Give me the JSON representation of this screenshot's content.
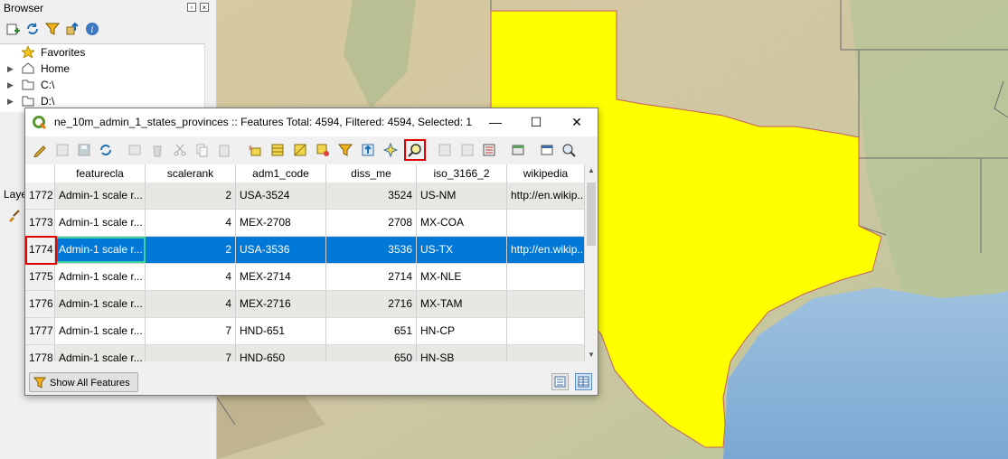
{
  "browser": {
    "title": "Browser",
    "tree": [
      {
        "label": "Favorites"
      },
      {
        "label": "Home"
      },
      {
        "label": "C:\\"
      },
      {
        "label": "D:\\"
      }
    ],
    "layers_label": "Laye"
  },
  "attr_window": {
    "title": "ne_10m_admin_1_states_provinces :: Features Total: 4594, Filtered: 4594, Selected: 1",
    "columns": [
      "featurecla",
      "scalerank",
      "adm1_code",
      "diss_me",
      "iso_3166_2",
      "wikipedia"
    ],
    "rows": [
      {
        "id": "1772",
        "featurecla": "Admin-1 scale r...",
        "scalerank": "2",
        "adm1_code": "USA-3524",
        "diss_me": "3524",
        "iso_3166_2": "US-NM",
        "wikipedia": "http://en.wikip..."
      },
      {
        "id": "1773",
        "featurecla": "Admin-1 scale r...",
        "scalerank": "4",
        "adm1_code": "MEX-2708",
        "diss_me": "2708",
        "iso_3166_2": "MX-COA",
        "wikipedia": ""
      },
      {
        "id": "1774",
        "featurecla": "Admin-1 scale r...",
        "scalerank": "2",
        "adm1_code": "USA-3536",
        "diss_me": "3536",
        "iso_3166_2": "US-TX",
        "wikipedia": "http://en.wikip..."
      },
      {
        "id": "1775",
        "featurecla": "Admin-1 scale r...",
        "scalerank": "4",
        "adm1_code": "MEX-2714",
        "diss_me": "2714",
        "iso_3166_2": "MX-NLE",
        "wikipedia": ""
      },
      {
        "id": "1776",
        "featurecla": "Admin-1 scale r...",
        "scalerank": "4",
        "adm1_code": "MEX-2716",
        "diss_me": "2716",
        "iso_3166_2": "MX-TAM",
        "wikipedia": ""
      },
      {
        "id": "1777",
        "featurecla": "Admin-1 scale r...",
        "scalerank": "7",
        "adm1_code": "HND-651",
        "diss_me": "651",
        "iso_3166_2": "HN-CP",
        "wikipedia": ""
      },
      {
        "id": "1778",
        "featurecla": "Admin-1 scale r...",
        "scalerank": "7",
        "adm1_code": "HND-650",
        "diss_me": "650",
        "iso_3166_2": "HN-SB",
        "wikipedia": ""
      }
    ],
    "selected_row_id": "1774",
    "show_all_label": "Show All Features"
  },
  "colors": {
    "selection": "#0078d7",
    "highlight_box": "#e00000",
    "selected_feature": "#ffff00",
    "water": "#8db5d8"
  },
  "icons": [
    "search-icon",
    "filter-icon",
    "refresh-icon",
    "pencil-icon",
    "save-icon",
    "delete-icon",
    "zoom-to-selection-icon"
  ]
}
